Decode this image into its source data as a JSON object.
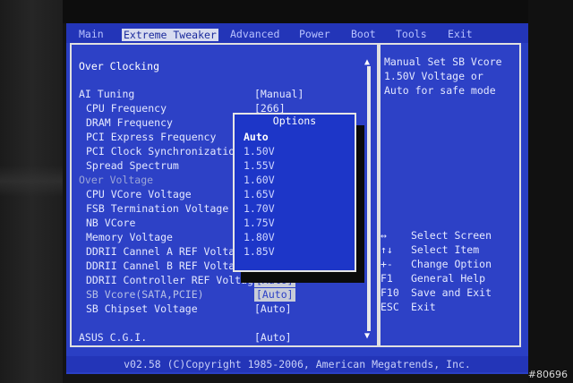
{
  "menu": {
    "items": [
      "Main",
      "Extreme Tweaker",
      "Advanced",
      "Power",
      "Boot",
      "Tools",
      "Exit"
    ],
    "active": "Extreme Tweaker"
  },
  "main": {
    "section_title": "Over Clocking",
    "rows": [
      {
        "label": "AI Tuning",
        "value": "[Manual]"
      },
      {
        "label": "CPU Frequency",
        "value": "[266]"
      },
      {
        "label": "DRAM Frequency",
        "value": ""
      },
      {
        "label": "PCI Express Frequency",
        "value": ""
      },
      {
        "label": "PCI Clock Synchronization",
        "value": ""
      },
      {
        "label": "Spread Spectrum",
        "value": ""
      },
      {
        "label": "Over Voltage",
        "value": ""
      },
      {
        "label": "CPU VCore Voltage",
        "value": ""
      },
      {
        "label": "FSB Termination Voltage",
        "value": ""
      },
      {
        "label": "NB VCore",
        "value": ""
      },
      {
        "label": "Memory Voltage",
        "value": ""
      },
      {
        "label": "DDRII Cannel A REF Voltage",
        "value": ""
      },
      {
        "label": "DDRII Cannel B REF Voltage",
        "value": ""
      },
      {
        "label": "DDRII Controller REF Voltage",
        "value": "[Auto]"
      },
      {
        "label": "SB Vcore(SATA,PCIE)",
        "value": "[Auto]"
      },
      {
        "label": "SB Chipset Voltage",
        "value": "[Auto]"
      },
      {
        "label": "ASUS C.G.I.",
        "value": "[Auto]"
      }
    ]
  },
  "options_popup": {
    "title": "Options",
    "items": [
      "Auto",
      "1.50V",
      "1.55V",
      "1.60V",
      "1.65V",
      "1.70V",
      "1.75V",
      "1.80V",
      "1.85V"
    ],
    "selected": "Auto"
  },
  "help": {
    "line1": "Manual Set SB Vcore",
    "line2": "1.50V Voltage or",
    "line3": "Auto for safe mode"
  },
  "keys": [
    {
      "key": "↔",
      "desc": "Select Screen"
    },
    {
      "key": "↑↓",
      "desc": "Select Item"
    },
    {
      "key": "+-",
      "desc": "Change Option"
    },
    {
      "key": "F1",
      "desc": "General Help"
    },
    {
      "key": "F10",
      "desc": "Save and Exit"
    },
    {
      "key": "ESC",
      "desc": "Exit"
    }
  ],
  "footer": "v02.58 (C)Copyright 1985-2006, American Megatrends, Inc.",
  "watermark": "#80696",
  "colors": {
    "screen_bg": "#2a3fc4",
    "popup_bg": "#1d36c8",
    "menu_active_bg": "#d8dcf0"
  }
}
